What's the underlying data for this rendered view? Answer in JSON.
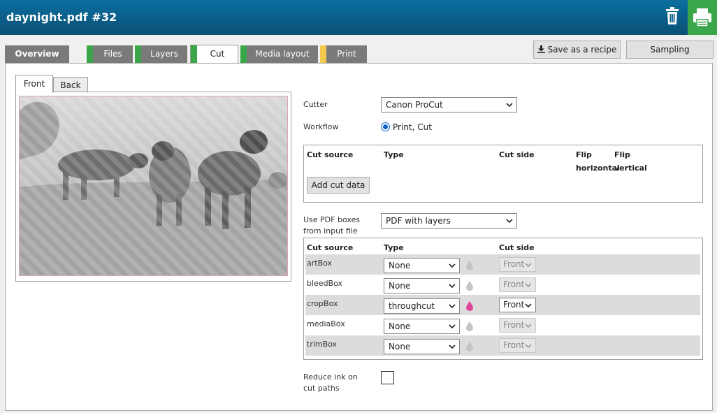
{
  "window": {
    "title": "daynight.pdf #32"
  },
  "colors": {
    "accent": "#0b5c86",
    "green": "#3aa64a",
    "yellow": "#f2c94c",
    "magenta": "#e0449a"
  },
  "tabs": [
    {
      "label": "Overview",
      "stripe": ""
    },
    {
      "label": "Files",
      "stripe": "#3aa64a"
    },
    {
      "label": "Layers",
      "stripe": "#3aa64a"
    },
    {
      "label": "Cut",
      "stripe": "#3aa64a"
    },
    {
      "label": "Media layout",
      "stripe": "#3aa64a"
    },
    {
      "label": "Print",
      "stripe": "#f2c94c"
    }
  ],
  "toolbar": {
    "save_recipe": "Save as a recipe",
    "sampling": "Sampling"
  },
  "subtabs": {
    "front": "Front",
    "back": "Back"
  },
  "cutter": {
    "label": "Cutter",
    "value": "Canon ProCut"
  },
  "workflow": {
    "label": "Workflow",
    "value": "Print, Cut"
  },
  "cut_table": {
    "headers": {
      "source": "Cut source",
      "type": "Type",
      "side": "Cut side",
      "flip_h1": "Flip",
      "flip_h2": "horizontal",
      "flip_v1": "Flip",
      "flip_v2": "vertical"
    },
    "add_button": "Add cut data"
  },
  "pdf_boxes": {
    "label1": "Use PDF boxes",
    "label2": "from input file",
    "value": "PDF with layers"
  },
  "box_table": {
    "headers": {
      "source": "Cut source",
      "type": "Type",
      "side": "Cut side"
    },
    "rows": [
      {
        "source": "artBox",
        "type": "None",
        "side": "Front",
        "side_enabled": false,
        "drop": "grey"
      },
      {
        "source": "bleedBox",
        "type": "None",
        "side": "Front",
        "side_enabled": false,
        "drop": "grey"
      },
      {
        "source": "cropBox",
        "type": "throughcut",
        "side": "Front",
        "side_enabled": true,
        "drop": "magenta"
      },
      {
        "source": "mediaBox",
        "type": "None",
        "side": "Front",
        "side_enabled": false,
        "drop": "grey"
      },
      {
        "source": "trimBox",
        "type": "None",
        "side": "Front",
        "side_enabled": false,
        "drop": "grey"
      }
    ]
  },
  "reduce_ink": {
    "label1": "Reduce ink on",
    "label2": "cut paths"
  }
}
